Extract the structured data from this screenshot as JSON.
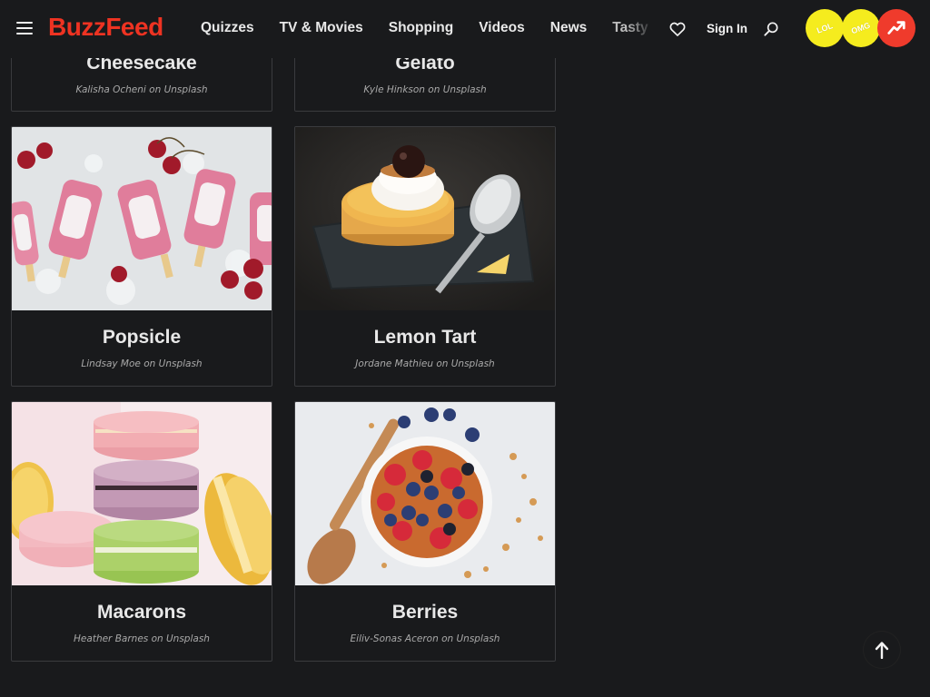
{
  "header": {
    "logo": "BuzzFeed",
    "nav": [
      "Quizzes",
      "TV & Movies",
      "Shopping",
      "Videos",
      "News",
      "Tasty"
    ],
    "sign_in": "Sign In",
    "badges": [
      {
        "label": "LOL",
        "color": "#f5ec1e"
      },
      {
        "label": "OMG",
        "color": "#f5ec1e"
      },
      {
        "label": "trending",
        "color": "#ef3b2c"
      }
    ],
    "logo_color": "#ee3322"
  },
  "cards": [
    {
      "title": "Cheesecake",
      "credit": "Kalisha Ocheni on Unsplash",
      "image": "cheesecake-photo"
    },
    {
      "title": "Gelato",
      "credit": "Kyle Hinkson on Unsplash",
      "image": "gelato-photo"
    },
    {
      "title": "Popsicle",
      "credit": "Lindsay Moe on Unsplash",
      "image": "popsicle-photo"
    },
    {
      "title": "Lemon Tart",
      "credit": "Jordane Mathieu on Unsplash",
      "image": "lemon-tart-photo"
    },
    {
      "title": "Macarons",
      "credit": "Heather Barnes on Unsplash",
      "image": "macarons-photo"
    },
    {
      "title": "Berries",
      "credit": "Eiliv-Sonas Aceron on Unsplash",
      "image": "berries-photo"
    }
  ],
  "colors": {
    "background": "#191a1c",
    "card_border": "#3a3b3e"
  }
}
